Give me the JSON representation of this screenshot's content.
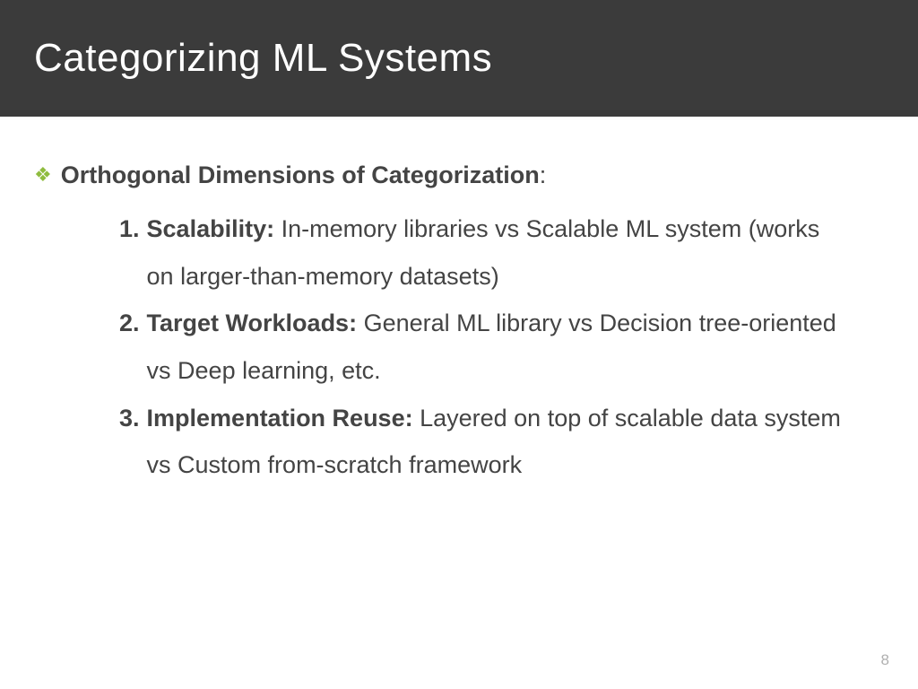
{
  "header": {
    "title": "Categorizing ML Systems"
  },
  "content": {
    "main_bullet": "Orthogonal Dimensions of Categorization",
    "main_bullet_colon": ":",
    "items": [
      {
        "number": "1.",
        "label": "Scalability:",
        "desc": " In-memory libraries vs Scalable ML system (works on larger-than-memory datasets)"
      },
      {
        "number": "2.",
        "label": "Target Workloads:",
        "desc": " General ML library vs Decision tree-oriented vs Deep learning, etc."
      },
      {
        "number": "3.",
        "label": "Implementation Reuse:",
        "desc": " Layered on top of scalable data system vs Custom from-scratch framework"
      }
    ]
  },
  "page_number": "8"
}
